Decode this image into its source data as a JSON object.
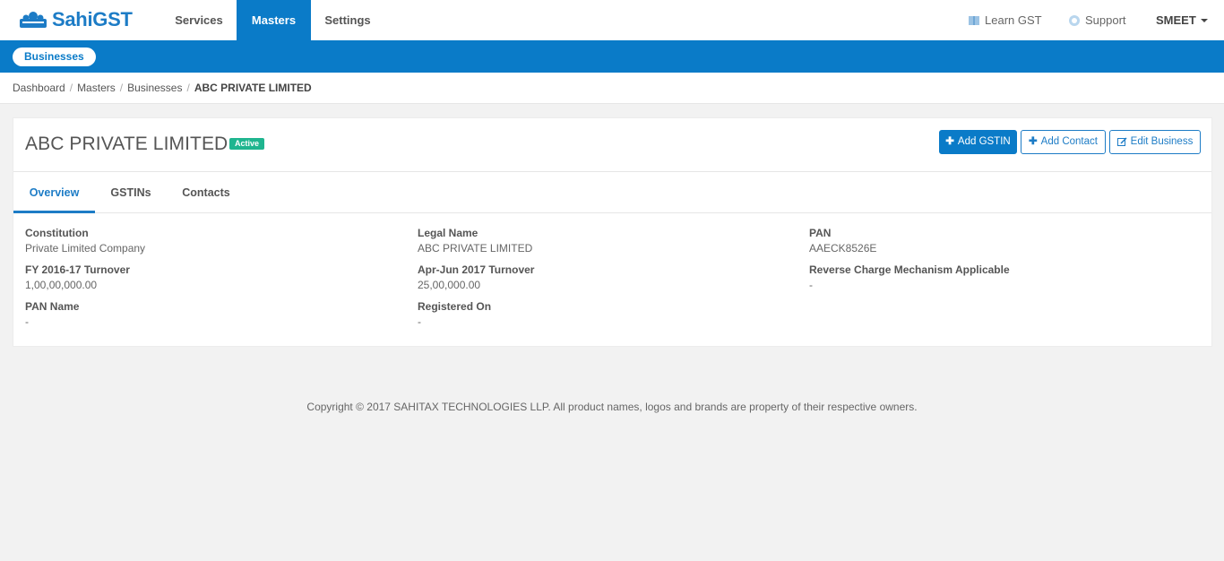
{
  "app": {
    "logo_text": "SahiGST",
    "nav": {
      "services": "Services",
      "masters": "Masters",
      "settings": "Settings"
    },
    "right": {
      "learn": "Learn GST",
      "support": "Support",
      "user": "SMEET"
    }
  },
  "subnav": {
    "pill": "Businesses"
  },
  "breadcrumb": {
    "items": [
      "Dashboard",
      "Masters",
      "Businesses"
    ],
    "current": "ABC PRIVATE LIMITED"
  },
  "business": {
    "title": "ABC PRIVATE LIMITED",
    "status": "Active",
    "buttons": {
      "add_gstin": "Add GSTIN",
      "add_contact": "Add Contact",
      "edit_business": "Edit Business"
    },
    "tabs": [
      "Overview",
      "GSTINs",
      "Contacts"
    ],
    "fields": {
      "constitution": {
        "label": "Constitution",
        "value": "Private Limited Company"
      },
      "legal_name": {
        "label": "Legal Name",
        "value": "ABC PRIVATE LIMITED"
      },
      "pan": {
        "label": "PAN",
        "value": "AAECK8526E"
      },
      "fy_turnover": {
        "label": "FY 2016-17 Turnover",
        "value": "1,00,00,000.00"
      },
      "q_turnover": {
        "label": "Apr-Jun 2017 Turnover",
        "value": "25,00,000.00"
      },
      "reverse_charge": {
        "label": "Reverse Charge Mechanism Applicable",
        "value": "-"
      },
      "pan_name": {
        "label": "PAN Name",
        "value": "-"
      },
      "registered_on": {
        "label": "Registered On",
        "value": "-"
      }
    }
  },
  "footer": {
    "text": "Copyright © 2017 SAHITAX TECHNOLOGIES LLP. All product names, logos and brands are property of their respective owners."
  },
  "colors": {
    "brand": "#0a7bc8",
    "active_badge": "#1fb58f",
    "background": "#f2f2f2"
  }
}
